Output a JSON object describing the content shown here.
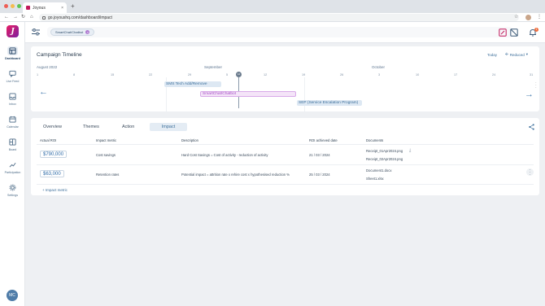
{
  "browser": {
    "tab_title": "Joyous",
    "tab_close": "×",
    "new_tab": "+",
    "url": "go.joyoushq.com/dashboard/impact",
    "colors": {
      "close": "#ee5e56",
      "min": "#f5bd4f",
      "max": "#5fc454"
    }
  },
  "sidebar": {
    "logo": "J",
    "items": [
      {
        "label": "Dashboard",
        "icon": "dashboard-icon"
      },
      {
        "label": "Live Feed",
        "icon": "chat-icon"
      },
      {
        "label": "Inbox",
        "icon": "inbox-icon"
      },
      {
        "label": "Calendar",
        "icon": "calendar-icon"
      },
      {
        "label": "Board",
        "icon": "board-icon"
      },
      {
        "label": "Participation",
        "icon": "trend-icon"
      },
      {
        "label": "Settings",
        "icon": "gear-icon"
      }
    ],
    "avatar_initials": "MC"
  },
  "header": {
    "chip_label": "SmartChat/Chatbot",
    "chip_remove": "×",
    "notification_count": "1",
    "accent": "#c2185b"
  },
  "timeline": {
    "title": "Campaign Timeline",
    "today_label": "Today",
    "zoom_label": "Reduced",
    "months": [
      "August 2022",
      "September",
      "October"
    ],
    "ticks": [
      "1",
      "8",
      "15",
      "22",
      "29",
      "5",
      "12",
      "19",
      "26",
      "3",
      "10",
      "17",
      "24",
      "31"
    ],
    "today_marker": "12",
    "bars": [
      {
        "label": "SMS Tech Add/Remove"
      },
      {
        "label": "SmartChat/Chatbot"
      },
      {
        "label": "SEP (Service Escalation Program)"
      }
    ]
  },
  "impact": {
    "tabs": [
      "Overview",
      "Themes",
      "Action",
      "Impact"
    ],
    "active_tab": "Impact",
    "columns": [
      "Actual ROI",
      "Impact metric",
      "Description",
      "ROI achieved date",
      "Documents"
    ],
    "rows": [
      {
        "roi": "$790,000",
        "metric": "Cost savings",
        "description": "Hard Cost Savings = Cost of activity - reduction of activity",
        "date": "21 / 03 / 2024",
        "documents": [
          "Receipt_01Apr2024.png",
          "Receipt_02Apr2024.png"
        ]
      },
      {
        "roi": "$63,000",
        "metric": "Retention rates",
        "description": "Potential impact = attrition rate x rehire cost x hypothesised reduction %",
        "date": "25 / 03 / 2024",
        "documents": [
          "Document1.docx",
          "Sheet1.xlsx"
        ]
      }
    ],
    "add_metric_label": "+ Impact metric"
  }
}
